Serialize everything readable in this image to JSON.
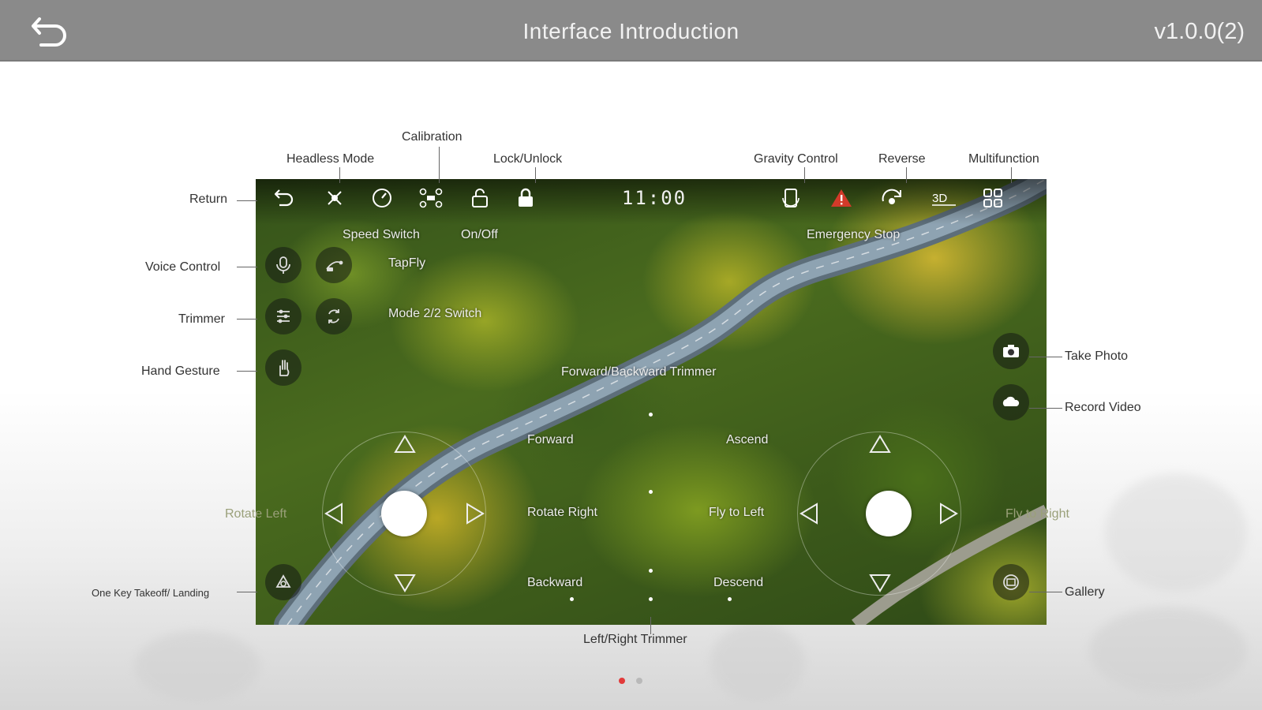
{
  "header": {
    "title": "Interface Introduction",
    "version": "v1.0.0(2)"
  },
  "screen": {
    "clock": "11:00"
  },
  "labels": {
    "return": "Return",
    "headless_mode": "Headless Mode",
    "calibration": "Calibration",
    "lock_unlock": "Lock/Unlock",
    "gravity_control": "Gravity Control",
    "reverse": "Reverse",
    "multifunction": "Multifunction",
    "speed_switch": "Speed Switch",
    "on_off": "On/Off",
    "emergency_stop": "Emergency Stop",
    "voice_control": "Voice Control",
    "tapfly": "TapFly",
    "trimmer": "Trimmer",
    "mode_switch": "Mode 2/2 Switch",
    "hand_gesture": "Hand Gesture",
    "forward_backward_trimmer": "Forward/Backward Trimmer",
    "forward": "Forward",
    "ascend": "Ascend",
    "rotate_left": "Rotate Left",
    "rotate_right": "Rotate Right",
    "fly_to_left": "Fly to Left",
    "fly_to_right": "Fly to Right",
    "backward": "Backward",
    "descend": "Descend",
    "one_key": "One Key Takeoff/ Landing",
    "gallery": "Gallery",
    "take_photo": "Take Photo",
    "record_video": "Record Video",
    "left_right_trimmer": "Left/Right Trimmer"
  },
  "pager": {
    "current": 1,
    "total": 2
  },
  "colors": {
    "topbar": "#8a8a8a",
    "pager_active": "#e23a3a",
    "emergency": "#d23a2a"
  }
}
